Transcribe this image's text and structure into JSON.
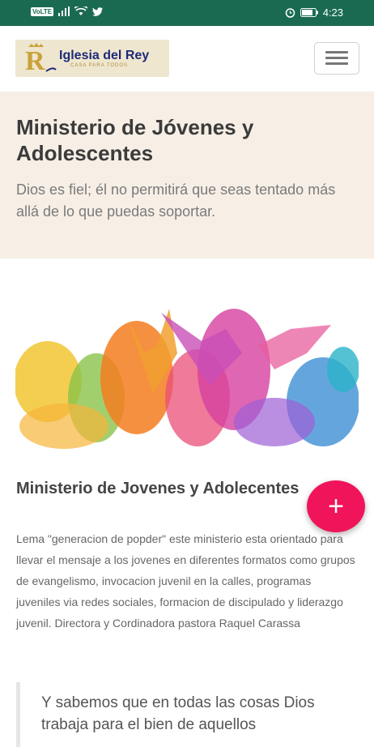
{
  "status_bar": {
    "network_badge": "VoLTE",
    "time": "4:23",
    "icons": [
      "signal-icon",
      "wifi-icon",
      "twitter-icon",
      "alarm-icon",
      "battery-icon"
    ]
  },
  "navbar": {
    "logo": {
      "title": "Iglesia del Rey",
      "subtitle": "CASA PARA TODOS"
    },
    "menu_icon": "hamburger-menu-icon"
  },
  "hero": {
    "title": "Ministerio de Jóvenes y Adolescentes",
    "verse": "Dios es fiel; él no permitirá que seas tentado más allá de lo que puedas soportar."
  },
  "article": {
    "title": "Ministerio de Jovenes y Adolecentes",
    "body": "Lema \"generacion de popder\" este ministerio esta orientado para llevar el mensaje a los jovenes en diferentes formatos como grupos de evangelismo, invocacion juvenil en la calles, programas juveniles via redes sociales, formacion de discipulado y liderazgo juvenil. Directora y Cordinadora pastora Raquel Carassa",
    "quote": "Y sabemos que en todas las cosas Dios trabaja para el bien de aquellos"
  },
  "fab": {
    "label": "+"
  },
  "colors": {
    "status_bar": "#1a6a52",
    "hero_bg": "#f7efe6",
    "fab": "#f0145b",
    "logo_title": "#1e2a78"
  }
}
